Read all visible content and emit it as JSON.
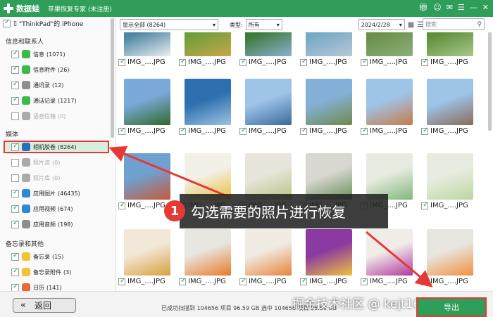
{
  "app": {
    "logo_text": "数据蛙",
    "title": "苹果恢复专家 (未注册)",
    "window_controls": [
      "gift-icon",
      "user-icon",
      "chat-icon",
      "menu-icon",
      "minimize-icon",
      "close-icon"
    ]
  },
  "sidebar": {
    "device": "\"ThinkPad\"的 iPhone",
    "sections": [
      {
        "title": "信息和联系人",
        "items": [
          {
            "label": "信息",
            "count": "(1071)",
            "icon_name": "message-icon",
            "color": "#3bba4c",
            "checked": true,
            "dim": false
          },
          {
            "label": "信息附件",
            "count": "(26)",
            "icon_name": "attachment-icon",
            "color": "#3bba4c",
            "checked": true,
            "dim": false
          },
          {
            "label": "通讯录",
            "count": "(12)",
            "icon_name": "contacts-icon",
            "color": "#8e8e8e",
            "checked": true,
            "dim": false
          },
          {
            "label": "通话记录",
            "count": "(1217)",
            "icon_name": "phone-icon",
            "color": "#3bba4c",
            "checked": true,
            "dim": false
          },
          {
            "label": "语音信箱",
            "count": "(0)",
            "icon_name": "voicemail-icon",
            "color": "#aaaaaa",
            "checked": false,
            "dim": true
          }
        ]
      },
      {
        "title": "媒体",
        "items": [
          {
            "label": "相机胶卷",
            "count": "(8264)",
            "icon_name": "camera-roll-icon",
            "color": "#2b6fb8",
            "checked": true,
            "dim": false,
            "selected": true
          },
          {
            "label": "照片流",
            "count": "(0)",
            "icon_name": "photo-stream-icon",
            "color": "#aaaaaa",
            "checked": false,
            "dim": true
          },
          {
            "label": "照片库",
            "count": "(0)",
            "icon_name": "photo-library-icon",
            "color": "#aaaaaa",
            "checked": false,
            "dim": true
          },
          {
            "label": "应用图片",
            "count": "(46435)",
            "icon_name": "app-photos-icon",
            "color": "#2b8ad6",
            "checked": true,
            "dim": false
          },
          {
            "label": "应用视频",
            "count": "(674)",
            "icon_name": "app-videos-icon",
            "color": "#2b8ad6",
            "checked": true,
            "dim": false
          },
          {
            "label": "应用音频",
            "count": "(198)",
            "icon_name": "app-audio-icon",
            "color": "#8e8e8e",
            "checked": true,
            "dim": false
          }
        ]
      },
      {
        "title": "备忘录和其他",
        "items": [
          {
            "label": "备忘录",
            "count": "(15)",
            "icon_name": "notes-icon",
            "color": "#f2c230",
            "checked": true,
            "dim": false
          },
          {
            "label": "备忘录附件",
            "count": "(3)",
            "icon_name": "notes-attachment-icon",
            "color": "#f2c230",
            "checked": true,
            "dim": false
          },
          {
            "label": "日历",
            "count": "(141)",
            "icon_name": "calendar-icon",
            "color": "#e86a3a",
            "checked": true,
            "dim": false
          }
        ]
      }
    ]
  },
  "toolbar": {
    "filter": "显示全部 (8264)",
    "type_label": "类型:",
    "type_value": "所有",
    "date": "2024/2/28",
    "search_placeholder": "搜索"
  },
  "photos": {
    "caption": "IMG_....JPG",
    "rows": [
      {
        "checked": true,
        "palettes": [
          [
            "#4f86a4",
            "#e8eef2"
          ],
          [
            "#6f9f3a",
            "#c8a64a"
          ],
          [
            "#3c7a3a",
            "#8cb0d0"
          ],
          [
            "#76a8c8",
            "#b5c9d4"
          ],
          [
            "#6b8f4a",
            "#8bb07a"
          ],
          [
            "#5f8f3a",
            "#a7c78a"
          ]
        ]
      },
      {
        "checked": true,
        "palettes": [
          [
            "#7aa8d8",
            "#2f6a2a"
          ],
          [
            "#2e6fb0",
            "#9bc4e0"
          ],
          [
            "#9ec4e8",
            "#3a6a9a"
          ],
          [
            "#84b0d8",
            "#6f8a4a"
          ],
          [
            "#9ec4e8",
            "#c97a4a"
          ],
          [
            "#9ec4e8",
            "#8a6a5a"
          ]
        ]
      },
      {
        "checked": true,
        "palettes": [
          [
            "#6fa0d0",
            "#c45a3a"
          ],
          [
            "#f2f0e8",
            "#e8c040"
          ],
          [
            "#e8e6dc",
            "#b8c080"
          ],
          [
            "#d8d8d0",
            "#6a8f5a"
          ],
          [
            "#e8ece0",
            "#7fb87a"
          ],
          [
            "#e8ece0",
            "#b8d8a0"
          ]
        ]
      },
      {
        "checked": true,
        "palettes": [
          [
            "#f2e8d8",
            "#d8a040"
          ],
          [
            "#e8e6e0",
            "#e87a2a"
          ],
          [
            "#f0ece4",
            "#e8843a"
          ],
          [
            "#8a3aa0",
            "#f0c040"
          ],
          [
            "#f0ece8",
            "#b03aa0"
          ],
          [
            "#e8e6e0",
            "#f09040"
          ]
        ]
      }
    ]
  },
  "callout": {
    "number": "1",
    "text": "勾选需要的照片进行恢复"
  },
  "bottom": {
    "back": "返回",
    "status": "已成功扫描到 104656 项目 96.59 GB   选中 104656 项目 96.59 GB",
    "export": "导出",
    "watermark": "掘金技术社区 @ kejt1688",
    "accent": "#2f9e58",
    "highlight": "#e53935"
  }
}
